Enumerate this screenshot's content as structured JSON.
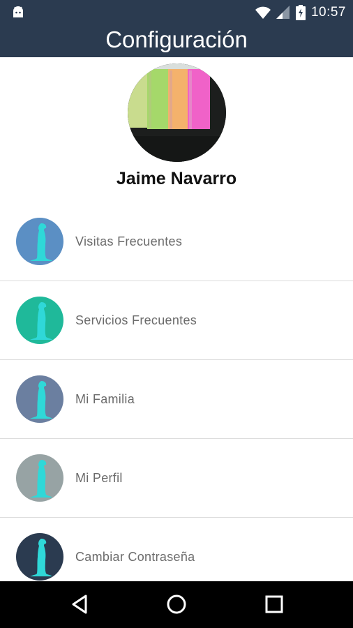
{
  "status_bar": {
    "time": "10:57",
    "icons": [
      "android-icon",
      "wifi-icon",
      "signal-icon",
      "battery-icon"
    ]
  },
  "app_bar": {
    "title": "Configuración"
  },
  "profile": {
    "name": "Jaime Navarro"
  },
  "menu": {
    "items": [
      {
        "label": "Visitas Frecuentes",
        "icon": "meerkat-icon",
        "color": "#5b8fc4"
      },
      {
        "label": "Servicios Frecuentes",
        "icon": "meerkat-icon",
        "color": "#1fb99a"
      },
      {
        "label": "Mi Familia",
        "icon": "meerkat-icon",
        "color": "#6b7fa0"
      },
      {
        "label": "Mi Perfil",
        "icon": "meerkat-icon",
        "color": "#97a3a4"
      },
      {
        "label": "Cambiar Contraseña",
        "icon": "meerkat-icon",
        "color": "#2b3b50"
      }
    ]
  },
  "nav_bar": {
    "buttons": [
      "back-icon",
      "home-icon",
      "recents-icon"
    ]
  },
  "colors": {
    "primary": "#2b3b50",
    "meerkat": "#2fd8d8"
  }
}
